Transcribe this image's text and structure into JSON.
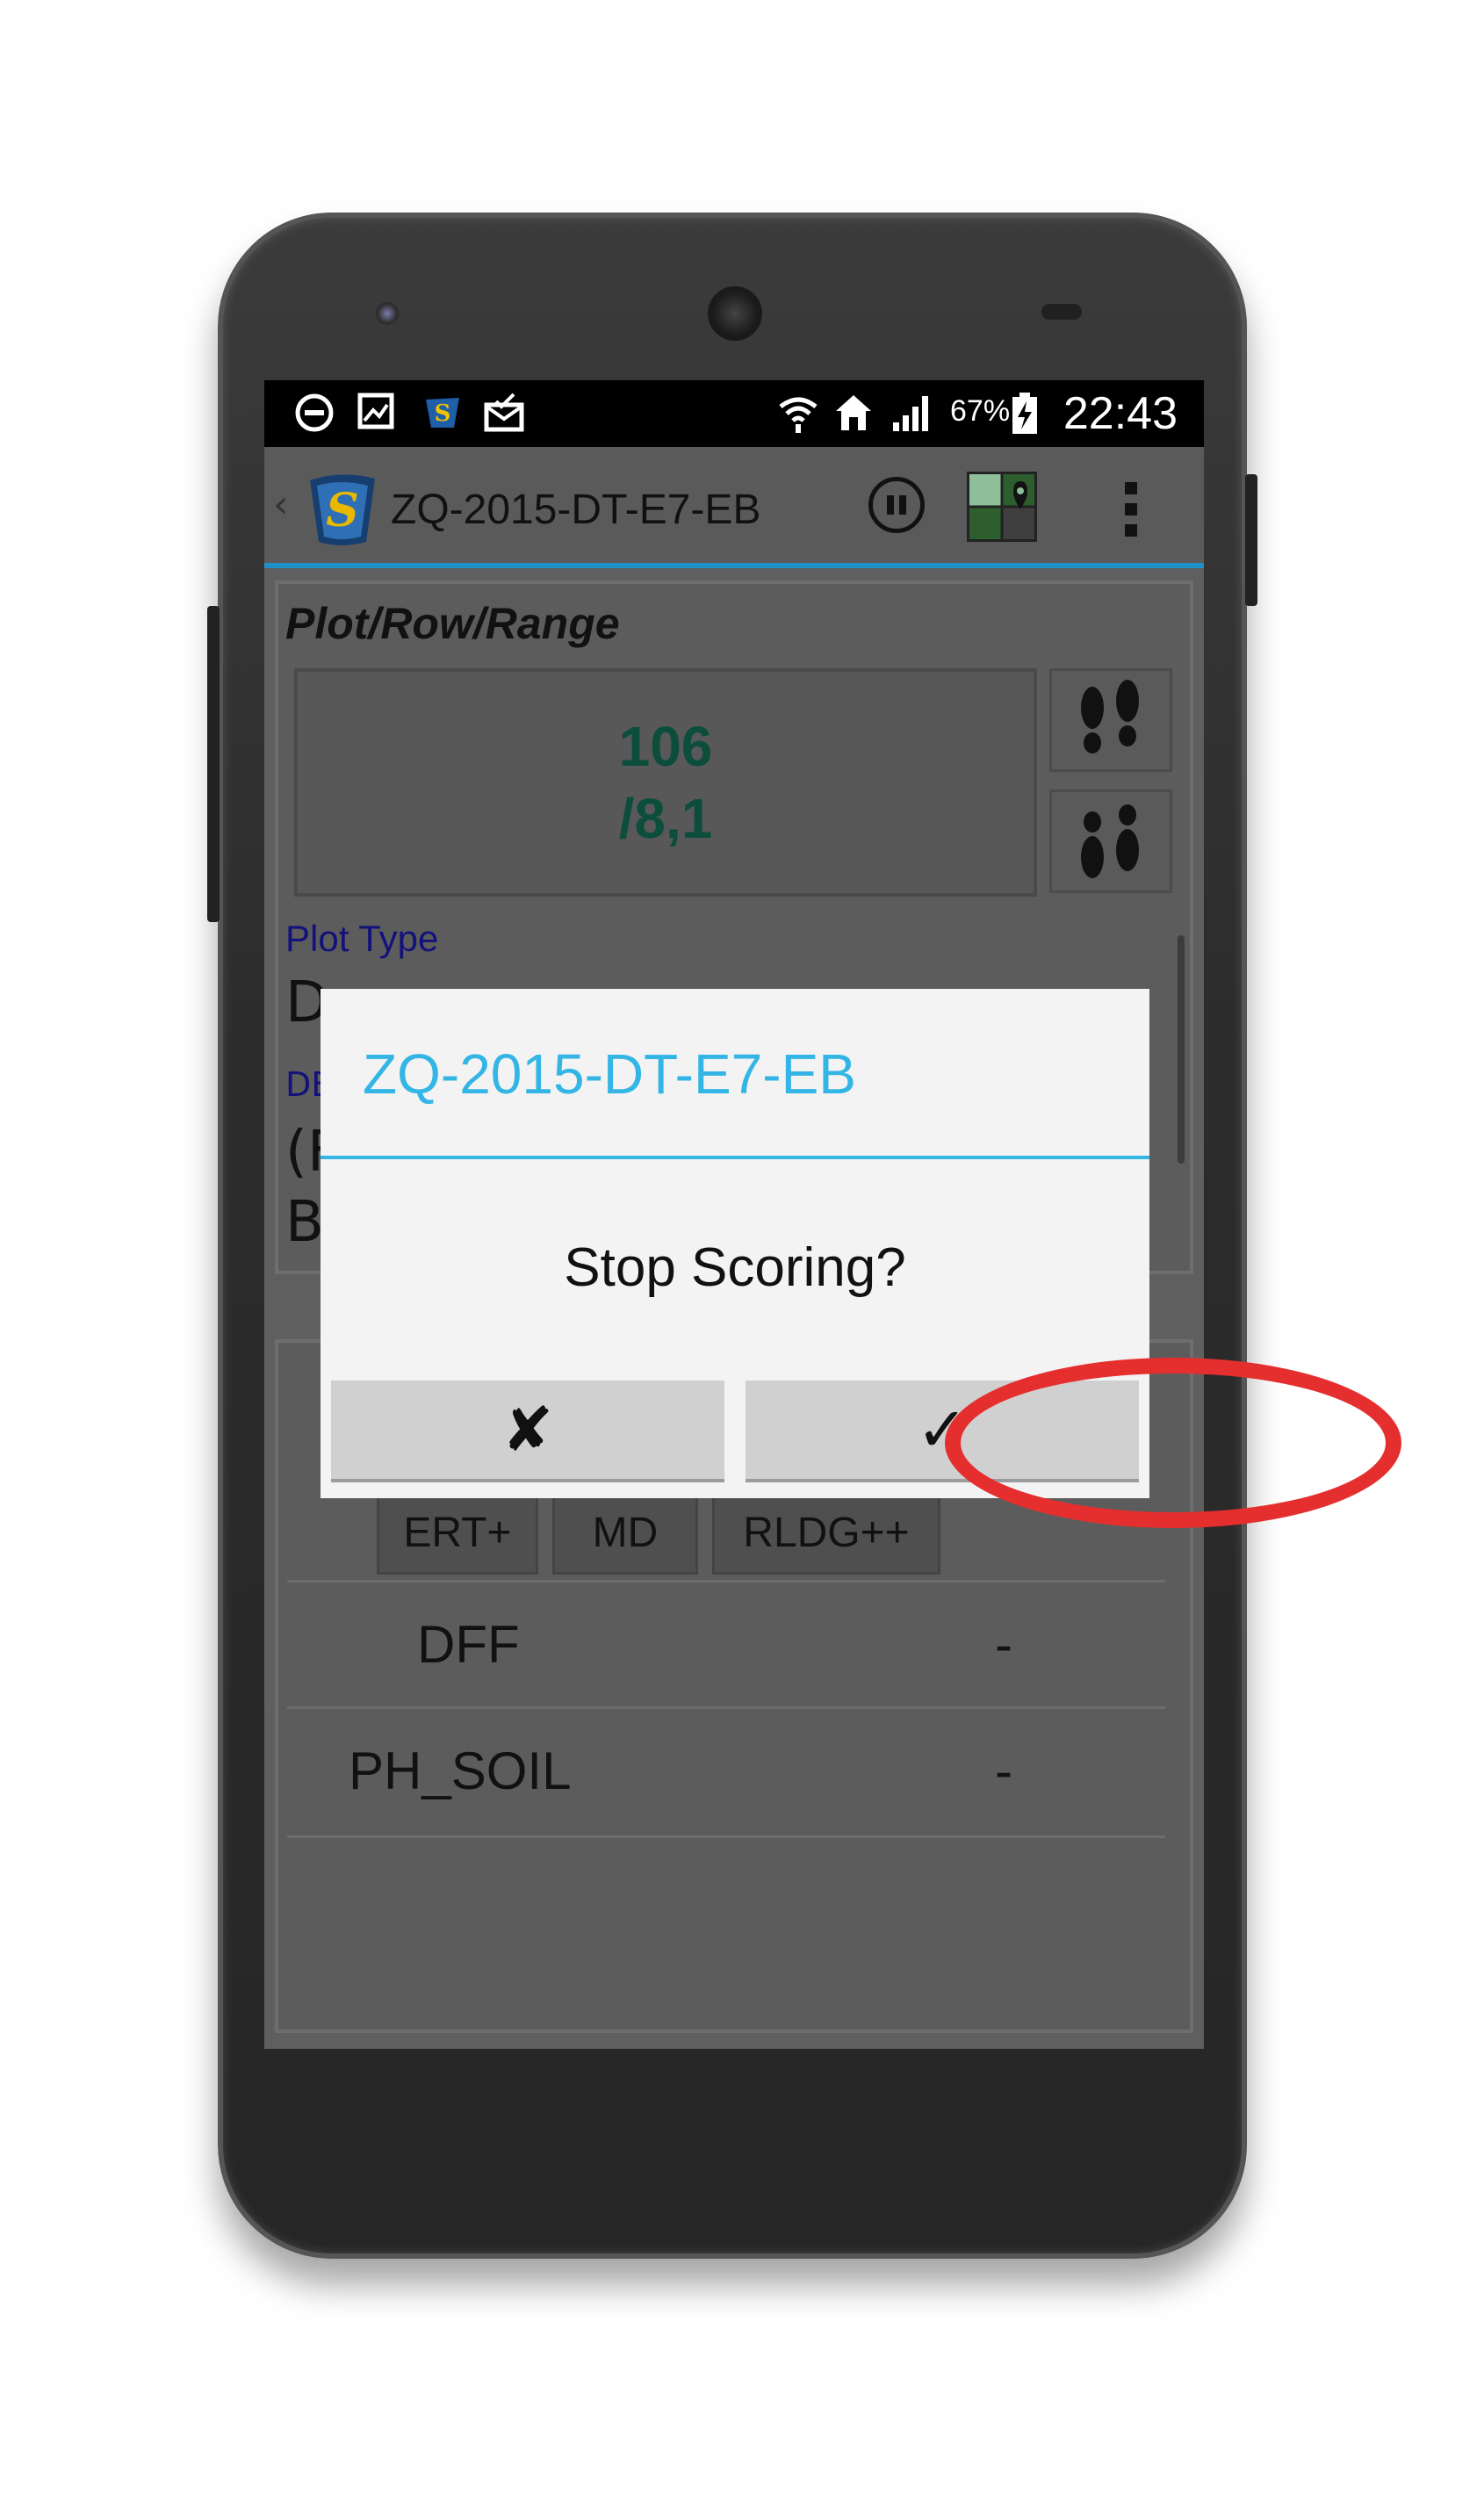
{
  "status_bar": {
    "battery_percent": "67%",
    "time": "22:43",
    "icons": [
      "do-not-disturb-icon",
      "image-notification-icon",
      "app-logo-notification-icon",
      "mail-notification-icon",
      "wifi-icon",
      "home-icon",
      "signal-icon",
      "battery-charging-icon"
    ]
  },
  "action_bar": {
    "title": "ZQ-2015-DT-E7-EB",
    "back_glyph": "‹",
    "icons": [
      "app-logo-icon",
      "pause-icon",
      "map-pin-icon",
      "overflow-menu-icon"
    ]
  },
  "plot": {
    "section_label": "Plot/Row/Range",
    "plot_number": "106",
    "row_range": "/8,1",
    "nav_icons": [
      "footprints-forward-icon",
      "footprints-backward-icon"
    ]
  },
  "attributes": {
    "plot_type_label": "Plot Type",
    "plot_type_value_fragment": "D",
    "second_label_fragment": "DE",
    "second_value_fragment_1": "(F",
    "second_value_fragment_2": "B"
  },
  "traits": {
    "buttons": [
      "ERT+",
      "MD",
      "RLDG++"
    ],
    "rows": [
      {
        "name": "DFF",
        "value": "-"
      },
      {
        "name": "PH_SOIL",
        "value": "-"
      }
    ]
  },
  "dialog": {
    "title": "ZQ-2015-DT-E7-EB",
    "message": "Stop Scoring?",
    "cancel_label": "✘",
    "confirm_label": "✓"
  },
  "colors": {
    "accent": "#33b5e5",
    "highlight": "#e52f2f",
    "plot_value": "#0d4d3c",
    "label_blue": "#12127a"
  }
}
